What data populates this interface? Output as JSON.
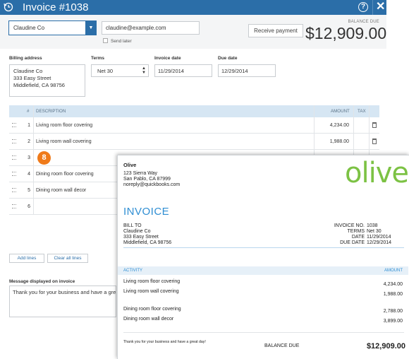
{
  "window": {
    "title": "Invoice #1038",
    "help_glyph": "?",
    "close_glyph": "✕"
  },
  "form": {
    "customer": "Claudine Co",
    "email": "claudine@example.com",
    "send_later_label": "Send later",
    "receive_payment_label": "Receive payment",
    "balance_due_label": "BALANCE DUE",
    "balance_due": "$12,909.00",
    "billing_address_label": "Billing address",
    "billing_address": [
      "Claudine Co",
      "333 Easy Street",
      "Middlefield, CA 98756"
    ],
    "terms_label": "Terms",
    "terms": "Net 30",
    "invoice_date_label": "Invoice date",
    "invoice_date": "11/29/2014",
    "due_date_label": "Due date",
    "due_date": "12/29/2014",
    "table": {
      "headers": {
        "num": "#",
        "description": "DESCRIPTION",
        "amount": "AMOUNT",
        "tax": "TAX"
      },
      "rows": [
        {
          "num": "1",
          "description": "Living room floor covering",
          "amount": "4,234.00"
        },
        {
          "num": "2",
          "description": "Living room wall covering",
          "amount": "1,988.00"
        },
        {
          "num": "3",
          "description": "",
          "amount": ""
        },
        {
          "num": "4",
          "description": "Dining room floor covering",
          "amount": ""
        },
        {
          "num": "5",
          "description": "Dining room wall decor",
          "amount": ""
        },
        {
          "num": "6",
          "description": "",
          "amount": ""
        }
      ]
    },
    "add_lines_label": "Add lines",
    "clear_lines_label": "Clear all lines",
    "message_label": "Message displayed on invoice",
    "message": "Thank you for your business and have a great"
  },
  "callout_badge": "8",
  "printed_invoice": {
    "company": "Olive",
    "company_address": [
      "123 Sierra Way",
      "San Pablo, CA  87999",
      "noreply@quickbooks.com"
    ],
    "logo_text": "olive",
    "title": "INVOICE",
    "bill_to_label": "BILL TO",
    "bill_to": [
      "Claudine Co",
      "333 Easy Street",
      "Middlefield, CA 98756"
    ],
    "meta_labels": [
      "INVOICE NO.",
      "TERMS",
      "DATE",
      "DUE DATE"
    ],
    "meta_values": [
      "1038",
      "Net 30",
      "11/29/2014",
      "12/29/2014"
    ],
    "activity_label": "ACTIVITY",
    "amount_label": "AMOUNT",
    "lines": [
      {
        "description": "Living room floor covering",
        "amount": "4,234.00"
      },
      {
        "description": "Living room wall covering",
        "amount": "1,988.00"
      },
      {
        "description": "Dining room floor covering",
        "amount": "2,788.00"
      },
      {
        "description": "Dining room wall decor",
        "amount": "3,899.00"
      }
    ],
    "thanks": "Thank you for your business and have a great day!",
    "balance_due_label": "BALANCE DUE",
    "balance_due": "$12,909.00"
  },
  "colors": {
    "brand_blue": "#2b6ea8",
    "badge_orange": "#ef7a1a",
    "logo_green": "#7cc244",
    "invoice_blue": "#2f8ed3"
  }
}
